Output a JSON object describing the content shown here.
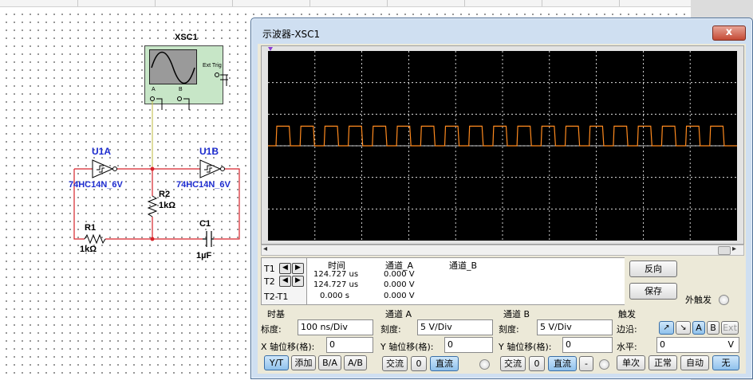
{
  "schematic": {
    "xsc_label": "XSC1",
    "ext_trig_label": "Ext Trig",
    "pin_a": "A",
    "pin_b": "B",
    "u1a_label": "U1A",
    "u1a_part": "74HC14N_6V",
    "u1b_label": "U1B",
    "u1b_part": "74HC14N_6V",
    "r2_label": "R2",
    "r2_value": "1kΩ",
    "r1_label": "R1",
    "r1_value": "1kΩ",
    "c1_label": "C1",
    "c1_value": "1µF",
    "wire_color": "#d6232a",
    "probe_color": "#c9c45e",
    "part_label_color": "#1c2bcf"
  },
  "window": {
    "title": "示波器-XSC1",
    "close_glyph": "x"
  },
  "cursors": {
    "t1_label": "T1",
    "t2_label": "T2",
    "t2t1_label": "T2-T1",
    "col_time": "时间",
    "col_cha": "通道_A",
    "col_chb": "通道_B",
    "t1_time": "124.727 us",
    "t1_cha": "0.000 V",
    "t2_time": "124.727 us",
    "t2_cha": "0.000 V",
    "dt_time": "0.000 s",
    "dt_cha": "0.000 V"
  },
  "actions": {
    "reverse": "反向",
    "save": "保存",
    "ext_trigger": "外触发"
  },
  "timebase": {
    "title": "时基",
    "scale_label": "标度:",
    "scale_value": "100 ns/Div",
    "xpos_label": "X 轴位移(格):",
    "xpos_value": "0",
    "btn_yt": "Y/T",
    "btn_add": "添加",
    "btn_ba": "B/A",
    "btn_ab": "A/B"
  },
  "channel_a": {
    "title": "通道 A",
    "scale_label": "刻度:",
    "scale_value": "5  V/Div",
    "ypos_label": "Y 轴位移(格):",
    "ypos_value": "0",
    "btn_ac": "交流",
    "btn_zero": "0",
    "btn_dc": "直流"
  },
  "channel_b": {
    "title": "通道 B",
    "scale_label": "刻度:",
    "scale_value": "5  V/Div",
    "ypos_label": "Y 轴位移(格):",
    "ypos_value": "0",
    "btn_ac": "交流",
    "btn_zero": "0",
    "btn_dc": "直流",
    "btn_minus": "-"
  },
  "trigger": {
    "title": "触发",
    "edge_label": "边沿:",
    "btn_rise": "↗",
    "btn_fall": "↘",
    "btn_a": "A",
    "btn_b": "B",
    "btn_ext": "Ext",
    "level_label": "水平:",
    "level_value": "0",
    "level_unit": "V",
    "btn_single": "单次",
    "btn_normal": "正常",
    "btn_auto": "自动",
    "btn_none": "无"
  },
  "trace": {
    "color": "#ff8a1e",
    "periods": 19,
    "high_div": 1.0
  }
}
